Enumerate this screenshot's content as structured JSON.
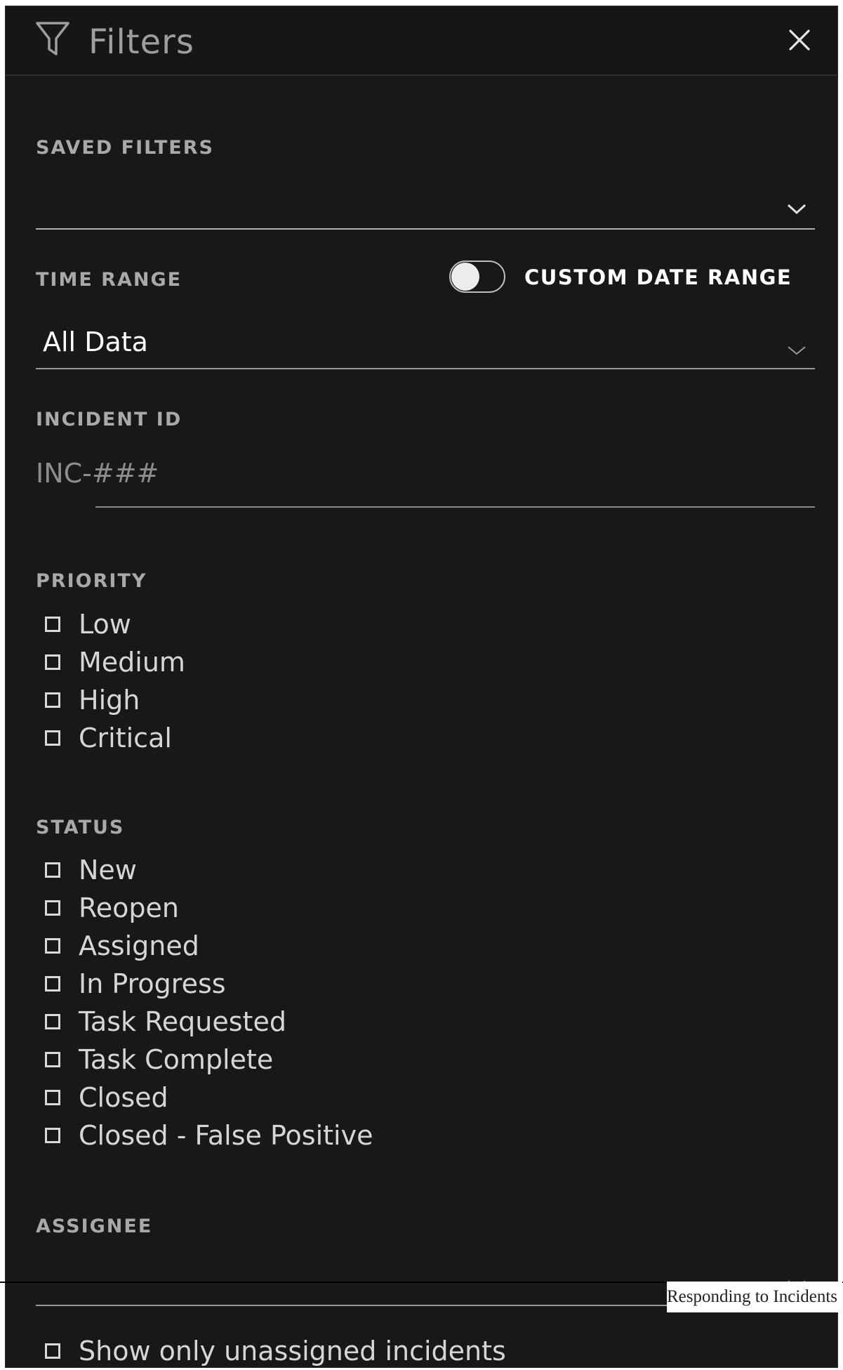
{
  "header": {
    "title": "Filters"
  },
  "saved_filters": {
    "label": "SAVED FILTERS",
    "value": ""
  },
  "time_range": {
    "label": "TIME RANGE",
    "toggle_label": "CUSTOM DATE RANGE",
    "toggle_on": false,
    "value": "All Data"
  },
  "incident_id": {
    "label": "INCIDENT ID",
    "placeholder": "INC-###",
    "value": ""
  },
  "priority": {
    "label": "PRIORITY",
    "options": [
      {
        "label": "Low",
        "checked": false
      },
      {
        "label": "Medium",
        "checked": false
      },
      {
        "label": "High",
        "checked": false
      },
      {
        "label": "Critical",
        "checked": false
      }
    ]
  },
  "status": {
    "label": "STATUS",
    "options": [
      {
        "label": "New",
        "checked": false
      },
      {
        "label": "Reopen",
        "checked": false
      },
      {
        "label": "Assigned",
        "checked": false
      },
      {
        "label": "In Progress",
        "checked": false
      },
      {
        "label": "Task Requested",
        "checked": false
      },
      {
        "label": "Task Complete",
        "checked": false
      },
      {
        "label": "Closed",
        "checked": false
      },
      {
        "label": "Closed - False Positive",
        "checked": false
      }
    ]
  },
  "assignee": {
    "label": "ASSIGNEE",
    "value": "",
    "unassigned_only_label": "Show only unassigned incidents",
    "unassigned_only_checked": false
  },
  "footer": {
    "caption": "Responding to Incidents"
  },
  "colors": {
    "panel_background": "#181818",
    "label_text": "#a9a9a9",
    "value_text": "#ffffff"
  }
}
